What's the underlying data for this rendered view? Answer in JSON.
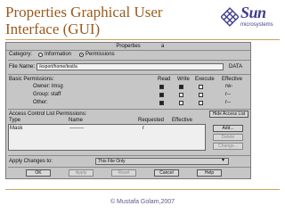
{
  "slide": {
    "title": "Properties Graphical User Interface (GUI)",
    "footer": "© Mustafa Golam,2007"
  },
  "logo": {
    "word": "Sun",
    "sub": "microsystems"
  },
  "dialog": {
    "title": "Properties",
    "title_extra": "a",
    "category_label": "Category:",
    "category_options": [
      "Information",
      "Permissions"
    ],
    "category_selected": "Permissions",
    "file_name_label": "File Name:",
    "file_name_value": "/export/home/test/a",
    "file_name_right": "DATA",
    "basic_permissions_label": "Basic Permissions:",
    "perm_headers": [
      "Read",
      "Write",
      "Execute",
      "Effective"
    ],
    "perm_rows": [
      {
        "label": "Owner: lmsg",
        "read": true,
        "write": true,
        "execute": false,
        "effective": "rw-"
      },
      {
        "label": "Group: staff",
        "read": true,
        "write": false,
        "execute": false,
        "effective": "r--"
      },
      {
        "label": "Other:",
        "read": true,
        "write": false,
        "execute": false,
        "effective": "r--"
      }
    ],
    "acl_label": "Access Control List Permissions:",
    "hide_acl": "Hide Access List",
    "acl_headers": [
      "Type",
      "Name",
      "Requested",
      "Effective"
    ],
    "acl_rows": [
      {
        "type": "Mask",
        "name": "--------",
        "requested": "r",
        "effective": ""
      }
    ],
    "acl_buttons": [
      "Add...",
      "Delete",
      "Change..."
    ],
    "apply_label": "Apply Changes to:",
    "apply_value": "This File Only",
    "buttons": [
      "OK",
      "Apply",
      "Reset",
      "Cancel",
      "Help"
    ]
  },
  "colors": {
    "title": "#9a5a1a",
    "logo": "#3f3f8a",
    "dialog_bg": "#c6c6c6",
    "rule": "#c9a25a"
  }
}
